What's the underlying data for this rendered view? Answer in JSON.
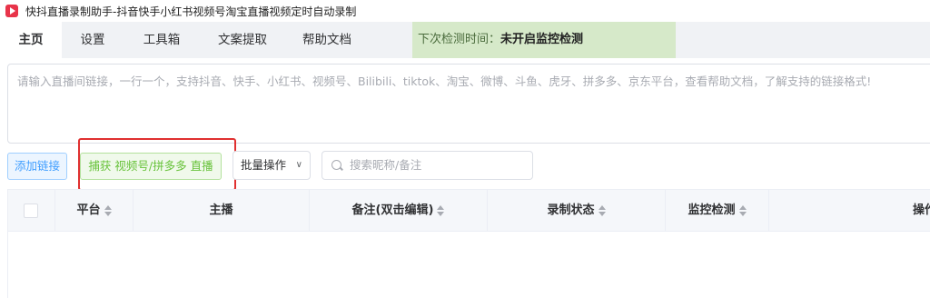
{
  "window": {
    "title": "快抖直播录制助手-抖音快手小红书视频号淘宝直播视频定时自动录制",
    "icon": "app-play-icon"
  },
  "tabs": [
    {
      "label": "主页",
      "active": true
    },
    {
      "label": "设置",
      "active": false
    },
    {
      "label": "工具箱",
      "active": false
    },
    {
      "label": "文案提取",
      "active": false
    },
    {
      "label": "帮助文档",
      "active": false
    }
  ],
  "next_check": {
    "label": "下次检测时间：",
    "value": "未开启监控检测"
  },
  "link_input": {
    "placeholder": "请输入直播间链接，一行一个，支持抖音、快手、小红书、视频号、Bilibili、tiktok、淘宝、微博、斗鱼、虎牙、拼多多、京东平台，查看帮助文档，了解支持的链接格式!"
  },
  "toolbar": {
    "add_link": "添加链接",
    "capture": "捕获 视频号/拼多多 直播",
    "batch": "批量操作",
    "search_placeholder": "搜索昵称/备注"
  },
  "table": {
    "columns": [
      "平台",
      "主播",
      "备注(双击编辑)",
      "录制状态",
      "监控检测",
      "操作"
    ],
    "rows": []
  },
  "colors": {
    "primary": "#409eff",
    "success": "#67c23a",
    "highlight_box": "#e03030",
    "next_check_bg": "#d6e9c9"
  }
}
